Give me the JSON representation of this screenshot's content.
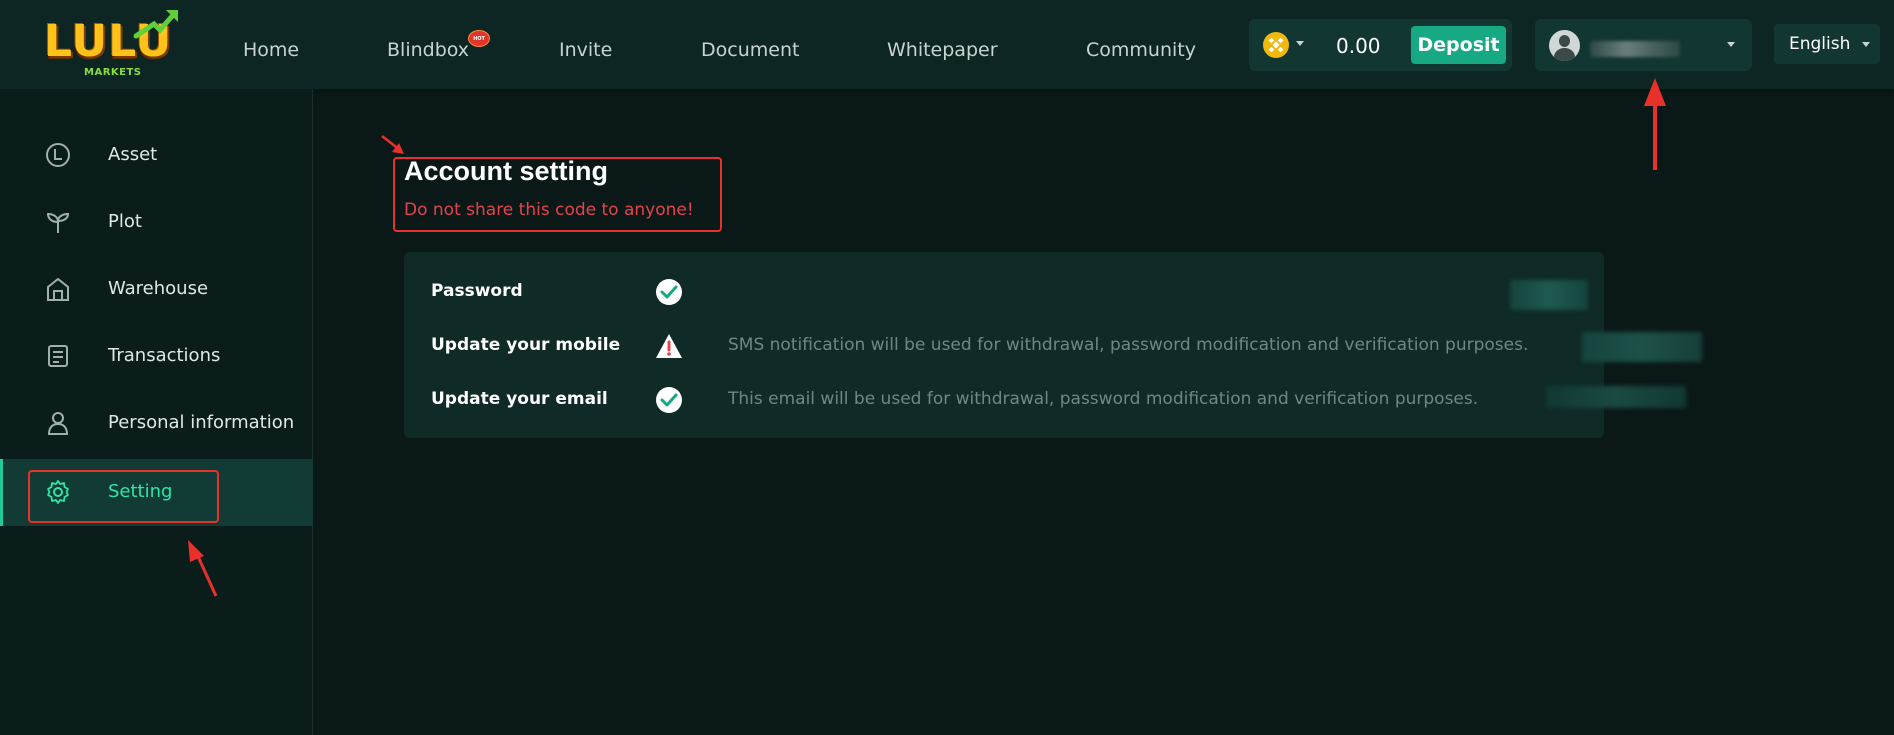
{
  "brand": {
    "name": "LULU",
    "subtitle": "MARKETS"
  },
  "nav": {
    "items": [
      {
        "label": "Home"
      },
      {
        "label": "Blindbox",
        "badge": "HOT"
      },
      {
        "label": "Invite"
      },
      {
        "label": "Document"
      },
      {
        "label": "Whitepaper"
      },
      {
        "label": "Community"
      }
    ]
  },
  "wallet": {
    "coin_icon": "bnb-coin-icon",
    "balance": "0.00",
    "deposit_label": "Deposit"
  },
  "user": {
    "avatar_icon": "user-avatar-icon"
  },
  "language": {
    "label": "English"
  },
  "sidebar": {
    "items": [
      {
        "label": "Asset",
        "icon": "asset-clock-icon",
        "active": false
      },
      {
        "label": "Plot",
        "icon": "plant-sprout-icon",
        "active": false
      },
      {
        "label": "Warehouse",
        "icon": "warehouse-icon",
        "active": false
      },
      {
        "label": "Transactions",
        "icon": "transactions-icon",
        "active": false
      },
      {
        "label": "Personal information",
        "icon": "person-icon",
        "active": false
      },
      {
        "label": "Setting",
        "icon": "gear-icon",
        "active": true
      }
    ]
  },
  "main": {
    "title": "Account setting",
    "warning": "Do not share this code to anyone!",
    "rows": [
      {
        "label": "Password",
        "status": "verified",
        "description": ""
      },
      {
        "label": "Update your mobile",
        "status": "warning",
        "description": "SMS notification will be used for withdrawal, password modification and verification purposes."
      },
      {
        "label": "Update your email",
        "status": "verified",
        "description": "This email will be used for withdrawal, password modification and verification purposes."
      }
    ]
  },
  "colors": {
    "accent": "#20c997",
    "deposit": "#17a983",
    "warning_text": "#e8414e",
    "annotation": "#e8312a",
    "background": "#0a1917"
  }
}
